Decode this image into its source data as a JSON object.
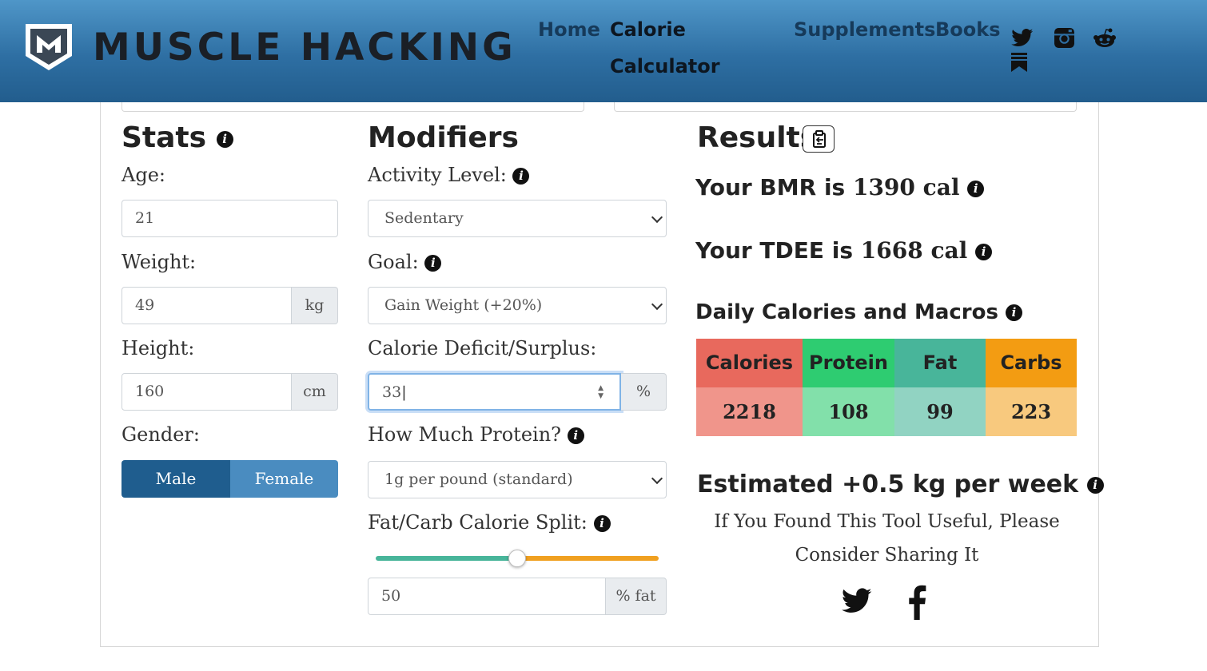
{
  "header": {
    "logo_text": "MUSCLE HACKING",
    "nav": {
      "home": "Home",
      "calorie_calculator_line1": "Calorie",
      "calorie_calculator_line2": "Calculator",
      "supplements": "Supplements",
      "books": "Books"
    },
    "social": [
      "twitter-icon",
      "bookmark-icon",
      "instagram-icon",
      "reddit-icon"
    ]
  },
  "stats": {
    "title": "Stats",
    "age_label": "Age:",
    "age_value": "21",
    "weight_label": "Weight:",
    "weight_value": "49",
    "weight_unit": "kg",
    "height_label": "Height:",
    "height_value": "160",
    "height_unit": "cm",
    "gender_label": "Gender:",
    "gender_male": "Male",
    "gender_female": "Female",
    "gender_selected": "Male"
  },
  "modifiers": {
    "title": "Modifiers",
    "activity_label": "Activity Level:",
    "activity_value": "Sedentary",
    "goal_label": "Goal:",
    "goal_value": "Gain Weight (+20%)",
    "deficit_label": "Calorie Deficit/Surplus:",
    "deficit_value": "33",
    "deficit_unit": "%",
    "protein_label": "How Much Protein?",
    "protein_value": "1g per pound (standard)",
    "split_label": "Fat/Carb Calorie Split:",
    "split_value": "50",
    "split_unit": "% fat",
    "split_fraction": 0.5
  },
  "results": {
    "title": "Results",
    "bmr_prefix": "Your BMR is",
    "bmr_value": "1390 cal",
    "tdee_prefix": "Your TDEE is",
    "tdee_value": "1668 cal",
    "macros_title": "Daily Calories and Macros",
    "macros": [
      {
        "name": "Calories",
        "value": "2218",
        "head_color": "#e8695d",
        "val_color": "#f0958b"
      },
      {
        "name": "Protein",
        "value": "108",
        "head_color": "#2ecc71",
        "val_color": "#82e0aa"
      },
      {
        "name": "Fat",
        "value": "99",
        "head_color": "#48b59a",
        "val_color": "#91d3c2"
      },
      {
        "name": "Carbs",
        "value": "223",
        "head_color": "#f39c12",
        "val_color": "#f8c97e"
      }
    ],
    "estimated": "Estimated +0.5 kg per week",
    "share_text": "If You Found This Tool Useful, Please Consider Sharing It"
  }
}
